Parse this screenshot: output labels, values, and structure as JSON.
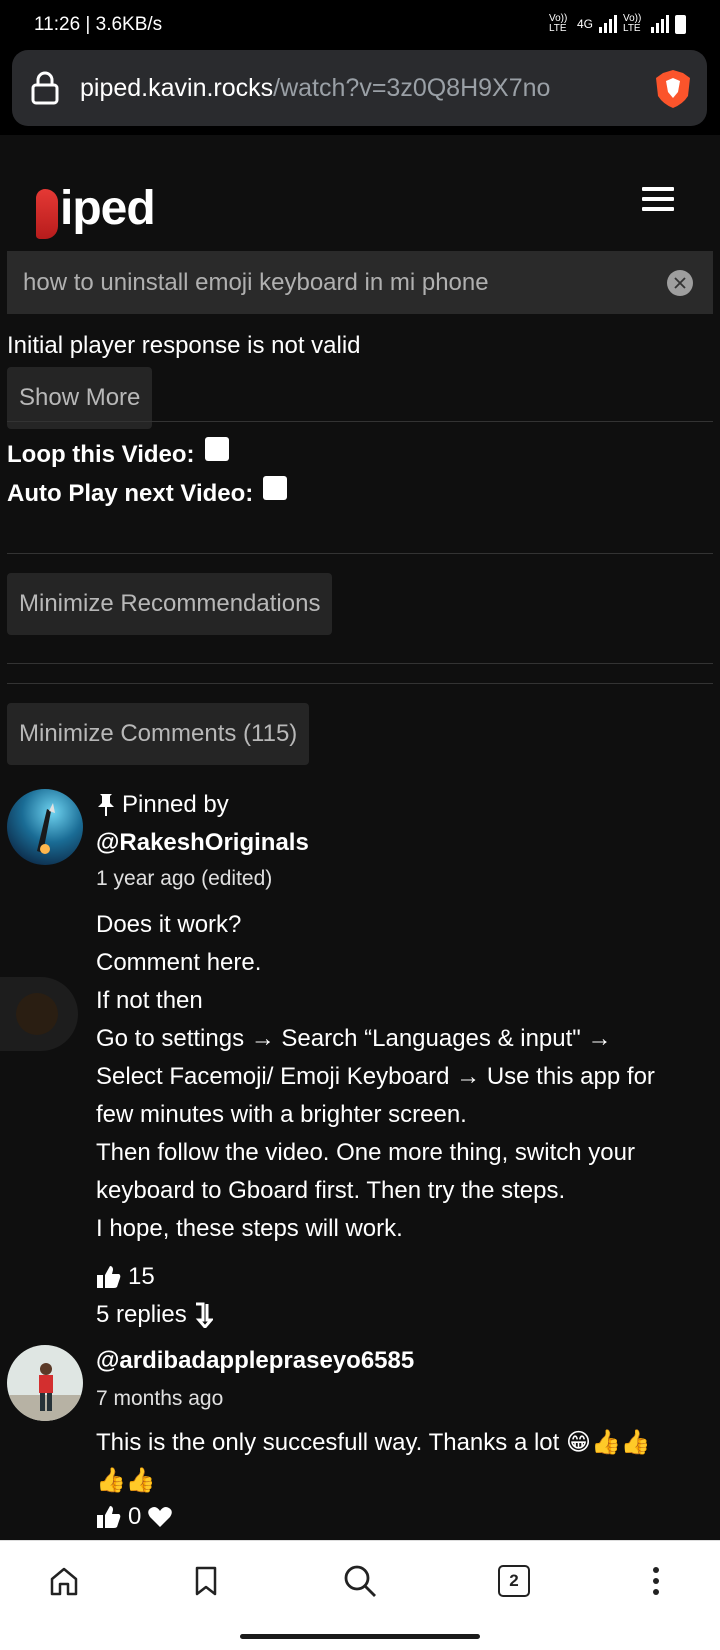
{
  "status_bar": {
    "time": "11:26 | 3.6KB/s",
    "volte1": "Vo)) LTE",
    "network": "4G",
    "volte2": "Vo)) LTE"
  },
  "browser": {
    "url_domain": "piped.kavin.rocks",
    "url_path": "/watch?v=3z0Q8H9X7no"
  },
  "app": {
    "logo_text": "iped"
  },
  "search": {
    "value": "how to uninstall emoji keyboard in mi phone"
  },
  "player": {
    "error": "Initial player response is not valid",
    "show_more_label": "Show More"
  },
  "options": {
    "loop_label": "Loop this Video:",
    "autoplay_label": "Auto Play next Video:"
  },
  "recommendations": {
    "minimize_label": "Minimize Recommendations"
  },
  "comments_section": {
    "minimize_label": "Minimize Comments (115)"
  },
  "comments": [
    {
      "pinned_text": "Pinned by",
      "author": "@RakeshOriginals",
      "time": "1 year ago (edited)",
      "lines": [
        "Does it work?",
        "Comment here.",
        "If not then",
        "Go to settings → Search “Languages & input\" →",
        "Select Facemoji/ Emoji Keyboard → Use this app for",
        "few minutes with a brighter screen.",
        "Then follow the video. One more thing, switch your",
        "keyboard to Gboard first. Then try the steps.",
        "I hope, these steps will work."
      ],
      "likes": "15",
      "replies": "5 replies"
    },
    {
      "author": "@ardibadapplepraseyo6585",
      "time": "7 months ago",
      "lines": [
        "This is the only succesfull way. Thanks a lot 😁👍👍",
        "👍👍"
      ],
      "likes": "0"
    }
  ],
  "bottom_nav": {
    "tab_count": "2"
  },
  "colors": {
    "background": "#0f0f0f",
    "button": "#252525",
    "button_text": "#b8b8b8",
    "logo_red": "#e53935"
  }
}
